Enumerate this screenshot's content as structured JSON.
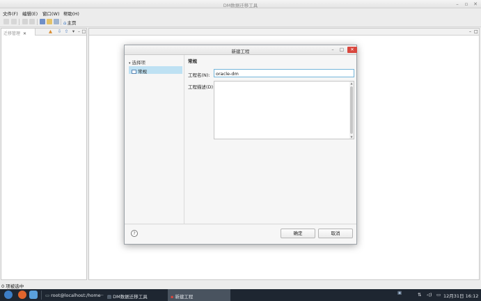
{
  "window": {
    "title": "DM数据迁移工具"
  },
  "menu": [
    "文件(F)",
    "编辑(E)",
    "窗口(W)",
    "帮助(H)"
  ],
  "toolbar": {
    "home_label": "主页"
  },
  "left_view": {
    "tab_label": "迁移管理"
  },
  "status": {
    "text": "0 项被选中"
  },
  "taskbar": {
    "items": [
      "root@localhost:/home···",
      "DM数据迁移工具",
      "新建工程"
    ],
    "clock": "12月31日 16:12"
  },
  "dialog": {
    "title": "新建工程",
    "nav_header": "选择项",
    "nav_selected": "常规",
    "section_title": "常规",
    "name_label": "工程名(N):",
    "name_value": "oracle-dm",
    "desc_label": "工程描述(D):",
    "ok_label": "确定",
    "cancel_label": "取消",
    "help_symbol": "?"
  },
  "colors": {
    "selection": "#bee1f3",
    "close_button": "#d9473e",
    "taskbar": "#1e2631",
    "focus_border": "#74b6da"
  }
}
